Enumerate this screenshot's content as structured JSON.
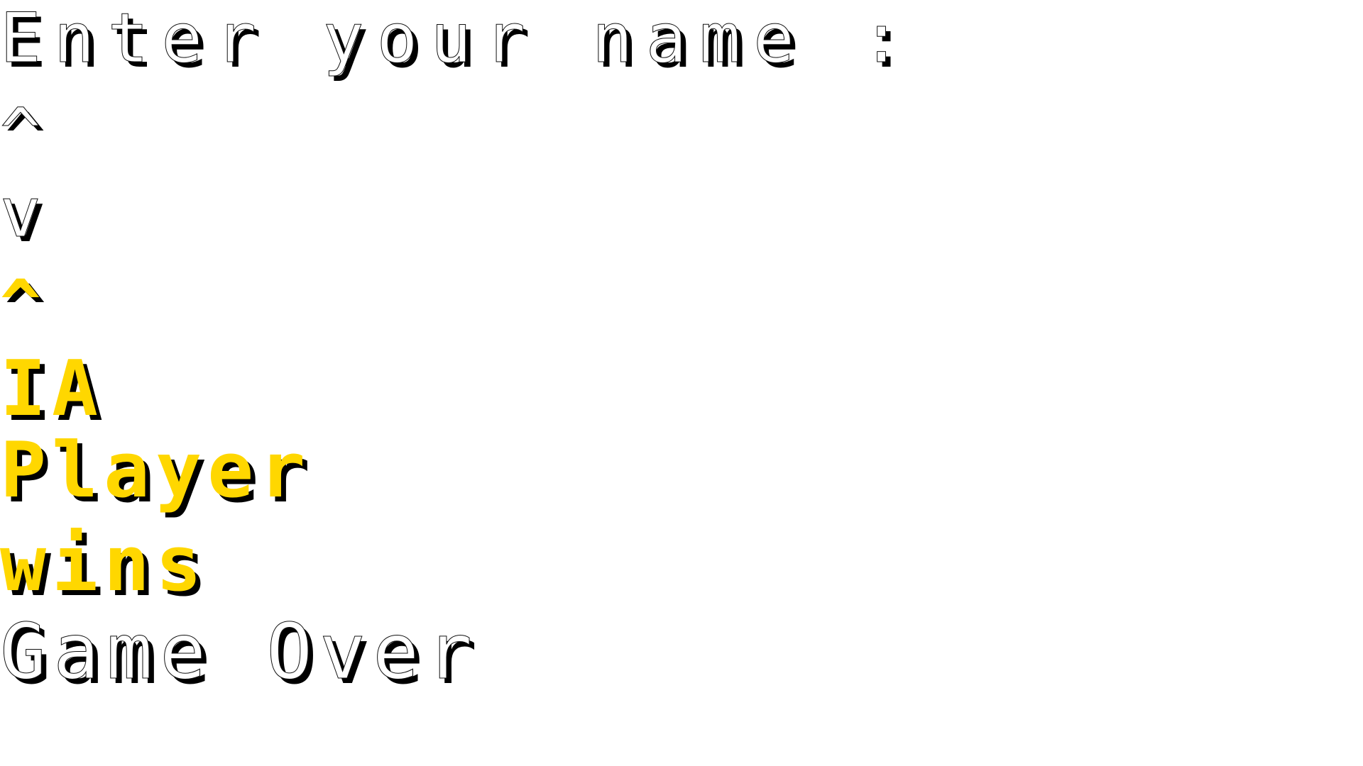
{
  "colors": {
    "background": "#ffffff",
    "text_white": "#ffffff",
    "text_yellow": "#ffd700",
    "shadow": "#000000"
  },
  "name_prompt": {
    "label": "Enter your name :"
  },
  "letter_selector": {
    "up_arrow_white": "^",
    "down_arrow_white": "v",
    "up_arrow_selected": "^"
  },
  "result": {
    "winner": "IA",
    "subject": "Player",
    "verb": "wins"
  },
  "status": {
    "game_over": "Game Over"
  }
}
